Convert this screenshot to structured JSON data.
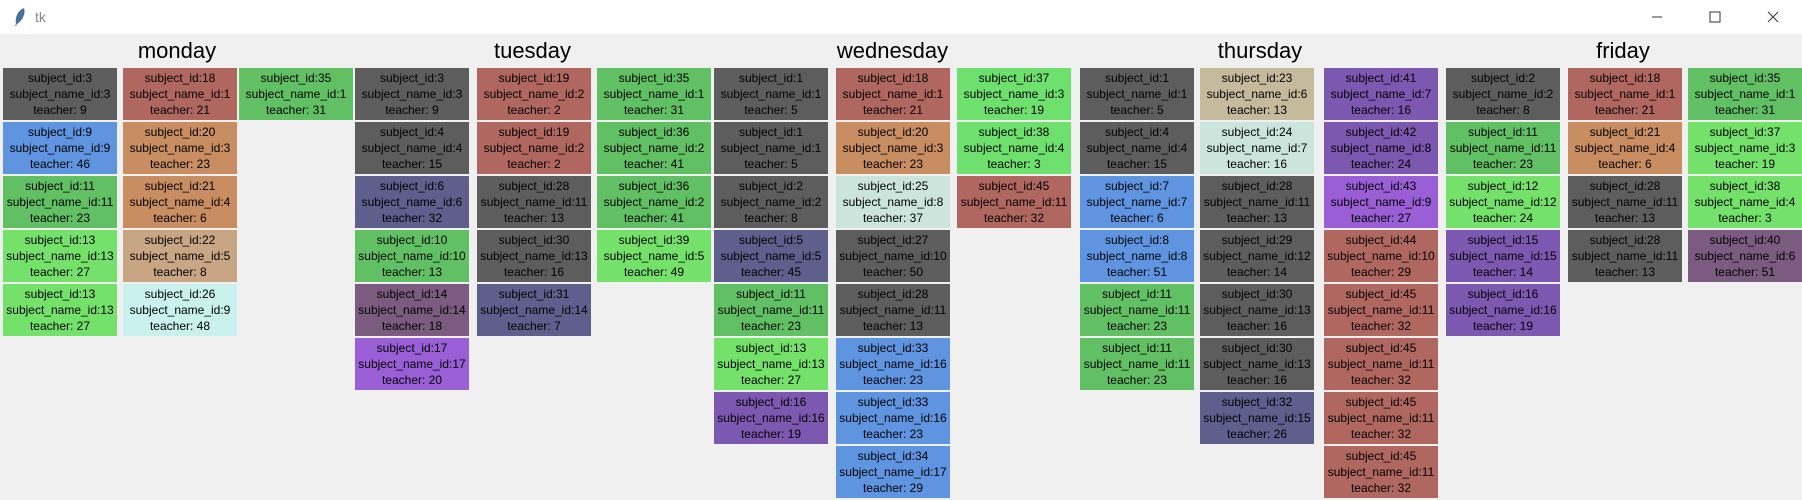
{
  "window": {
    "title": "tk"
  },
  "days": [
    "monday",
    "tuesday",
    "wednesday",
    "thursday",
    "friday"
  ],
  "colors": {
    "dark": "#5d5d5d",
    "red": "#b0675f",
    "green": "#62c064",
    "lightgreen": "#74e16a",
    "blue": "#5f94e0",
    "orange": "#c88d60",
    "tan": "#c8a683",
    "indigo": "#5e5f8c",
    "mauve": "#7b5b80",
    "purple": "#9a5fd6",
    "violet": "#7c58b1",
    "mint": "#cce5dc",
    "cyan": "#c9f1ee",
    "beige": "#c5ba9c",
    "lime": "#6de06d"
  },
  "columns": [
    [
      {
        "subject_id": "subject_id:3",
        "subject_name_id": "subject_name_id:3",
        "teacher": "teacher: 9",
        "color": "dark"
      },
      {
        "subject_id": "subject_id:9",
        "subject_name_id": "subject_name_id:9",
        "teacher": "teacher: 46",
        "color": "blue"
      },
      {
        "subject_id": "subject_id:11",
        "subject_name_id": "subject_name_id:11",
        "teacher": "teacher: 23",
        "color": "green"
      },
      {
        "subject_id": "subject_id:13",
        "subject_name_id": "subject_name_id:13",
        "teacher": "teacher: 27",
        "color": "lightgreen"
      },
      {
        "subject_id": "subject_id:13",
        "subject_name_id": "subject_name_id:13",
        "teacher": "teacher: 27",
        "color": "lightgreen"
      }
    ],
    [
      {
        "subject_id": "subject_id:18",
        "subject_name_id": "subject_name_id:1",
        "teacher": "teacher: 21",
        "color": "red"
      },
      {
        "subject_id": "subject_id:20",
        "subject_name_id": "subject_name_id:3",
        "teacher": "teacher: 23",
        "color": "orange"
      },
      {
        "subject_id": "subject_id:21",
        "subject_name_id": "subject_name_id:4",
        "teacher": "teacher: 6",
        "color": "orange"
      },
      {
        "subject_id": "subject_id:22",
        "subject_name_id": "subject_name_id:5",
        "teacher": "teacher: 8",
        "color": "tan"
      },
      {
        "subject_id": "subject_id:26",
        "subject_name_id": "subject_name_id:9",
        "teacher": "teacher: 48",
        "color": "cyan"
      }
    ],
    [
      {
        "subject_id": "subject_id:35",
        "subject_name_id": "subject_name_id:1",
        "teacher": "teacher: 31",
        "color": "green"
      }
    ],
    [
      {
        "subject_id": "subject_id:3",
        "subject_name_id": "subject_name_id:3",
        "teacher": "teacher: 9",
        "color": "dark"
      },
      {
        "subject_id": "subject_id:4",
        "subject_name_id": "subject_name_id:4",
        "teacher": "teacher: 15",
        "color": "dark"
      },
      {
        "subject_id": "subject_id:6",
        "subject_name_id": "subject_name_id:6",
        "teacher": "teacher: 32",
        "color": "indigo"
      },
      {
        "subject_id": "subject_id:10",
        "subject_name_id": "subject_name_id:10",
        "teacher": "teacher: 13",
        "color": "green"
      },
      {
        "subject_id": "subject_id:14",
        "subject_name_id": "subject_name_id:14",
        "teacher": "teacher: 18",
        "color": "mauve"
      },
      {
        "subject_id": "subject_id:17",
        "subject_name_id": "subject_name_id:17",
        "teacher": "teacher: 20",
        "color": "purple"
      }
    ],
    [
      {
        "subject_id": "subject_id:19",
        "subject_name_id": "subject_name_id:2",
        "teacher": "teacher: 2",
        "color": "red"
      },
      {
        "subject_id": "subject_id:19",
        "subject_name_id": "subject_name_id:2",
        "teacher": "teacher: 2",
        "color": "red"
      },
      {
        "subject_id": "subject_id:28",
        "subject_name_id": "subject_name_id:11",
        "teacher": "teacher: 13",
        "color": "dark"
      },
      {
        "subject_id": "subject_id:30",
        "subject_name_id": "subject_name_id:13",
        "teacher": "teacher: 16",
        "color": "dark"
      },
      {
        "subject_id": "subject_id:31",
        "subject_name_id": "subject_name_id:14",
        "teacher": "teacher: 7",
        "color": "indigo"
      }
    ],
    [
      {
        "subject_id": "subject_id:35",
        "subject_name_id": "subject_name_id:1",
        "teacher": "teacher: 31",
        "color": "green"
      },
      {
        "subject_id": "subject_id:36",
        "subject_name_id": "subject_name_id:2",
        "teacher": "teacher: 41",
        "color": "green"
      },
      {
        "subject_id": "subject_id:36",
        "subject_name_id": "subject_name_id:2",
        "teacher": "teacher: 41",
        "color": "green"
      },
      {
        "subject_id": "subject_id:39",
        "subject_name_id": "subject_name_id:5",
        "teacher": "teacher: 49",
        "color": "lightgreen"
      }
    ],
    [
      {
        "subject_id": "subject_id:1",
        "subject_name_id": "subject_name_id:1",
        "teacher": "teacher: 5",
        "color": "dark"
      },
      {
        "subject_id": "subject_id:1",
        "subject_name_id": "subject_name_id:1",
        "teacher": "teacher: 5",
        "color": "dark"
      },
      {
        "subject_id": "subject_id:2",
        "subject_name_id": "subject_name_id:2",
        "teacher": "teacher: 8",
        "color": "dark"
      },
      {
        "subject_id": "subject_id:5",
        "subject_name_id": "subject_name_id:5",
        "teacher": "teacher: 45",
        "color": "indigo"
      },
      {
        "subject_id": "subject_id:11",
        "subject_name_id": "subject_name_id:11",
        "teacher": "teacher: 23",
        "color": "green"
      },
      {
        "subject_id": "subject_id:13",
        "subject_name_id": "subject_name_id:13",
        "teacher": "teacher: 27",
        "color": "lightgreen"
      },
      {
        "subject_id": "subject_id:16",
        "subject_name_id": "subject_name_id:16",
        "teacher": "teacher: 19",
        "color": "violet"
      }
    ],
    [
      {
        "subject_id": "subject_id:18",
        "subject_name_id": "subject_name_id:1",
        "teacher": "teacher: 21",
        "color": "red"
      },
      {
        "subject_id": "subject_id:20",
        "subject_name_id": "subject_name_id:3",
        "teacher": "teacher: 23",
        "color": "orange"
      },
      {
        "subject_id": "subject_id:25",
        "subject_name_id": "subject_name_id:8",
        "teacher": "teacher: 37",
        "color": "mint"
      },
      {
        "subject_id": "subject_id:27",
        "subject_name_id": "subject_name_id:10",
        "teacher": "teacher: 50",
        "color": "dark"
      },
      {
        "subject_id": "subject_id:28",
        "subject_name_id": "subject_name_id:11",
        "teacher": "teacher: 13",
        "color": "dark"
      },
      {
        "subject_id": "subject_id:33",
        "subject_name_id": "subject_name_id:16",
        "teacher": "teacher: 23",
        "color": "blue"
      },
      {
        "subject_id": "subject_id:33",
        "subject_name_id": "subject_name_id:16",
        "teacher": "teacher: 23",
        "color": "blue"
      },
      {
        "subject_id": "subject_id:34",
        "subject_name_id": "subject_name_id:17",
        "teacher": "teacher: 29",
        "color": "blue"
      }
    ],
    [
      {
        "subject_id": "subject_id:37",
        "subject_name_id": "subject_name_id:3",
        "teacher": "teacher: 19",
        "color": "lime"
      },
      {
        "subject_id": "subject_id:38",
        "subject_name_id": "subject_name_id:4",
        "teacher": "teacher: 3",
        "color": "lime"
      },
      {
        "subject_id": "subject_id:45",
        "subject_name_id": "subject_name_id:11",
        "teacher": "teacher: 32",
        "color": "red"
      }
    ],
    [
      {
        "subject_id": "subject_id:1",
        "subject_name_id": "subject_name_id:1",
        "teacher": "teacher: 5",
        "color": "dark"
      },
      {
        "subject_id": "subject_id:4",
        "subject_name_id": "subject_name_id:4",
        "teacher": "teacher: 15",
        "color": "dark"
      },
      {
        "subject_id": "subject_id:7",
        "subject_name_id": "subject_name_id:7",
        "teacher": "teacher: 6",
        "color": "blue"
      },
      {
        "subject_id": "subject_id:8",
        "subject_name_id": "subject_name_id:8",
        "teacher": "teacher: 51",
        "color": "blue"
      },
      {
        "subject_id": "subject_id:11",
        "subject_name_id": "subject_name_id:11",
        "teacher": "teacher: 23",
        "color": "green"
      },
      {
        "subject_id": "subject_id:11",
        "subject_name_id": "subject_name_id:11",
        "teacher": "teacher: 23",
        "color": "green"
      }
    ],
    [
      {
        "subject_id": "subject_id:23",
        "subject_name_id": "subject_name_id:6",
        "teacher": "teacher: 13",
        "color": "beige"
      },
      {
        "subject_id": "subject_id:24",
        "subject_name_id": "subject_name_id:7",
        "teacher": "teacher: 16",
        "color": "mint"
      },
      {
        "subject_id": "subject_id:28",
        "subject_name_id": "subject_name_id:11",
        "teacher": "teacher: 13",
        "color": "dark"
      },
      {
        "subject_id": "subject_id:29",
        "subject_name_id": "subject_name_id:12",
        "teacher": "teacher: 14",
        "color": "dark"
      },
      {
        "subject_id": "subject_id:30",
        "subject_name_id": "subject_name_id:13",
        "teacher": "teacher: 16",
        "color": "dark"
      },
      {
        "subject_id": "subject_id:30",
        "subject_name_id": "subject_name_id:13",
        "teacher": "teacher: 16",
        "color": "dark"
      },
      {
        "subject_id": "subject_id:32",
        "subject_name_id": "subject_name_id:15",
        "teacher": "teacher: 26",
        "color": "indigo"
      }
    ],
    [
      {
        "subject_id": "subject_id:41",
        "subject_name_id": "subject_name_id:7",
        "teacher": "teacher: 16",
        "color": "violet"
      },
      {
        "subject_id": "subject_id:42",
        "subject_name_id": "subject_name_id:8",
        "teacher": "teacher: 24",
        "color": "violet"
      },
      {
        "subject_id": "subject_id:43",
        "subject_name_id": "subject_name_id:9",
        "teacher": "teacher: 27",
        "color": "purple"
      },
      {
        "subject_id": "subject_id:44",
        "subject_name_id": "subject_name_id:10",
        "teacher": "teacher: 29",
        "color": "red"
      },
      {
        "subject_id": "subject_id:45",
        "subject_name_id": "subject_name_id:11",
        "teacher": "teacher: 32",
        "color": "red"
      },
      {
        "subject_id": "subject_id:45",
        "subject_name_id": "subject_name_id:11",
        "teacher": "teacher: 32",
        "color": "red"
      },
      {
        "subject_id": "subject_id:45",
        "subject_name_id": "subject_name_id:11",
        "teacher": "teacher: 32",
        "color": "red"
      },
      {
        "subject_id": "subject_id:45",
        "subject_name_id": "subject_name_id:11",
        "teacher": "teacher: 32",
        "color": "red"
      }
    ],
    [
      {
        "subject_id": "subject_id:2",
        "subject_name_id": "subject_name_id:2",
        "teacher": "teacher: 8",
        "color": "dark"
      },
      {
        "subject_id": "subject_id:11",
        "subject_name_id": "subject_name_id:11",
        "teacher": "teacher: 23",
        "color": "green"
      },
      {
        "subject_id": "subject_id:12",
        "subject_name_id": "subject_name_id:12",
        "teacher": "teacher: 24",
        "color": "lightgreen"
      },
      {
        "subject_id": "subject_id:15",
        "subject_name_id": "subject_name_id:15",
        "teacher": "teacher: 14",
        "color": "violet"
      },
      {
        "subject_id": "subject_id:16",
        "subject_name_id": "subject_name_id:16",
        "teacher": "teacher: 19",
        "color": "violet"
      }
    ],
    [
      {
        "subject_id": "subject_id:18",
        "subject_name_id": "subject_name_id:1",
        "teacher": "teacher: 21",
        "color": "red"
      },
      {
        "subject_id": "subject_id:21",
        "subject_name_id": "subject_name_id:4",
        "teacher": "teacher: 6",
        "color": "orange"
      },
      {
        "subject_id": "subject_id:28",
        "subject_name_id": "subject_name_id:11",
        "teacher": "teacher: 13",
        "color": "dark"
      },
      {
        "subject_id": "subject_id:28",
        "subject_name_id": "subject_name_id:11",
        "teacher": "teacher: 13",
        "color": "dark"
      }
    ],
    [
      {
        "subject_id": "subject_id:35",
        "subject_name_id": "subject_name_id:1",
        "teacher": "teacher: 31",
        "color": "green"
      },
      {
        "subject_id": "subject_id:37",
        "subject_name_id": "subject_name_id:3",
        "teacher": "teacher: 19",
        "color": "lightgreen"
      },
      {
        "subject_id": "subject_id:38",
        "subject_name_id": "subject_name_id:4",
        "teacher": "teacher: 3",
        "color": "lightgreen"
      },
      {
        "subject_id": "subject_id:40",
        "subject_name_id": "subject_name_id:6",
        "teacher": "teacher: 51",
        "color": "mauve"
      }
    ]
  ]
}
